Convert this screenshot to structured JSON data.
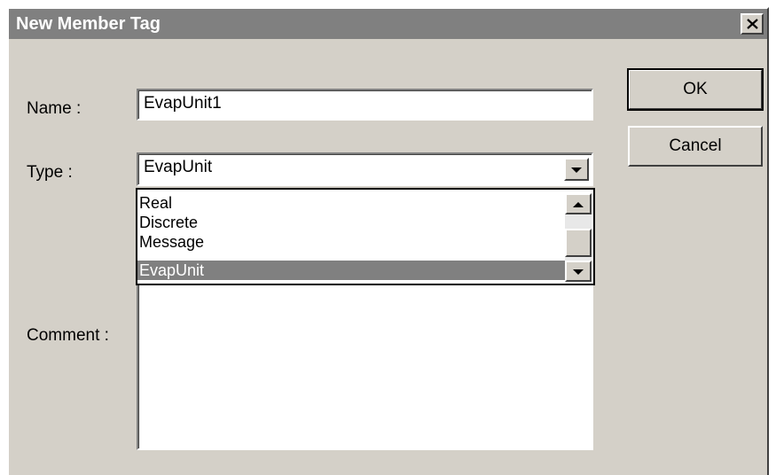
{
  "dialog": {
    "title": "New Member Tag",
    "close_glyph": "×",
    "close_icon": "close-x-icon"
  },
  "form": {
    "name_label": "Name :",
    "name_value": "EvapUnit1",
    "type_label": "Type :",
    "type_value": "EvapUnit",
    "comment_label": "Comment :",
    "comment_value": ""
  },
  "type_dropdown": {
    "icon": "chevron-down-icon",
    "options": [
      "Real",
      "Discrete",
      "Message",
      "EvapUnit"
    ],
    "selected": "EvapUnit"
  },
  "buttons": {
    "ok_label": "OK",
    "cancel_label": "Cancel"
  },
  "colors": {
    "titlebar": "#808080",
    "face": "#d4d0c8",
    "selection": "#808080"
  }
}
